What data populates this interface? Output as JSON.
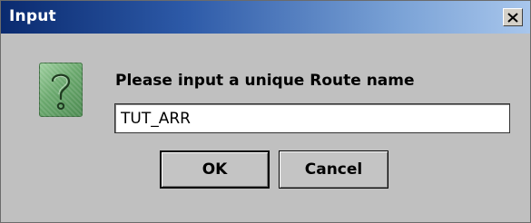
{
  "window": {
    "title": "Input",
    "close_label": "×"
  },
  "dialog": {
    "icon": "question-icon",
    "message": "Please input a unique Route name",
    "input_value": "TUT_ARR"
  },
  "buttons": {
    "ok_label": "OK",
    "cancel_label": "Cancel"
  },
  "colors": {
    "dialog_background": "#c0c0c0",
    "titlebar_start": "#0a2a6f",
    "titlebar_end": "#a8c6ec",
    "icon_green": "#6aa86d"
  }
}
